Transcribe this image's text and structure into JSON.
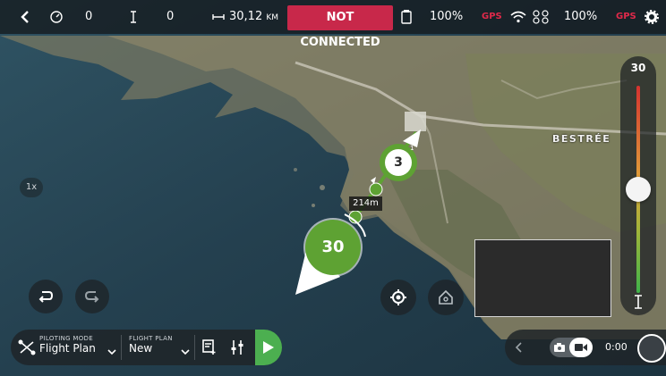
{
  "topbar": {
    "back_icon": "chevron-left-icon",
    "timer_value": "0",
    "altitude_value": "0",
    "distance_value": "30,12",
    "distance_unit": "KM",
    "connection_status": "NOT CONNECTED",
    "controller_battery": "100%",
    "controller_gps": "GPS",
    "drone_battery": "100%",
    "drone_gps": "GPS",
    "settings_icon": "gear-icon"
  },
  "map": {
    "place_label": "BESTRÉE",
    "zoom_badge": "1x",
    "distance_label": "214m",
    "waypoint_large_value": "30",
    "waypoint_small_value": "3",
    "waypoint_small_index": "1"
  },
  "altitude_slider": {
    "value": "30",
    "level_fraction": 0.5
  },
  "bottom_left": {
    "piloting_mode_label": "PILOTING MODE",
    "piloting_mode_value": "Flight Plan",
    "flight_plan_label": "FLIGHT PLAN",
    "flight_plan_value": "New"
  },
  "recording": {
    "time": "0:00"
  },
  "colors": {
    "accent_green": "#5ea233",
    "danger_red": "#c8284a",
    "play_green": "#4caf50"
  }
}
